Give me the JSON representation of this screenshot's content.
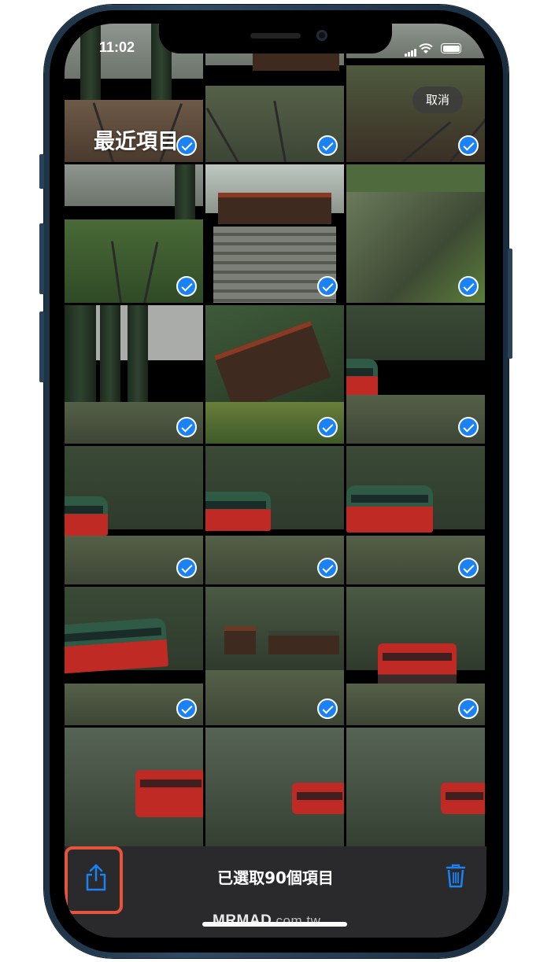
{
  "status_bar": {
    "time": "11:02"
  },
  "album": {
    "title": "最近項目"
  },
  "header": {
    "cancel_label": "取消"
  },
  "toolbar": {
    "selection_label": "已選取90個項目"
  },
  "watermark": {
    "brand": "MRMAD",
    "domain": ".com.tw"
  },
  "photos": [
    {
      "subject": "boardwalk-railway",
      "selected": true
    },
    {
      "subject": "station-platform",
      "selected": true
    },
    {
      "subject": "moss-track",
      "selected": true
    },
    {
      "subject": "walkway-rails",
      "selected": true
    },
    {
      "subject": "shrine-stairs",
      "selected": true
    },
    {
      "subject": "moss-log",
      "selected": true
    },
    {
      "subject": "forest-station",
      "selected": true
    },
    {
      "subject": "temple-roof",
      "selected": true
    },
    {
      "subject": "train-platform",
      "selected": true
    },
    {
      "subject": "red-train",
      "selected": true
    },
    {
      "subject": "red-train",
      "selected": true
    },
    {
      "subject": "red-train",
      "selected": true
    },
    {
      "subject": "red-train-side",
      "selected": true
    },
    {
      "subject": "station-umbrellas",
      "selected": true
    },
    {
      "subject": "red-locomotive",
      "selected": true
    },
    {
      "subject": "forest-locomotive",
      "selected": false
    },
    {
      "subject": "forest-locomotive",
      "selected": false
    },
    {
      "subject": "forest-locomotive",
      "selected": false
    }
  ],
  "colors": {
    "accent": "#1a82f5",
    "highlight": "#e8533d",
    "toolbar": "#2a2a2c"
  },
  "icons": {
    "share": "share-icon",
    "trash": "trash-icon",
    "check": "checkmark-icon"
  }
}
